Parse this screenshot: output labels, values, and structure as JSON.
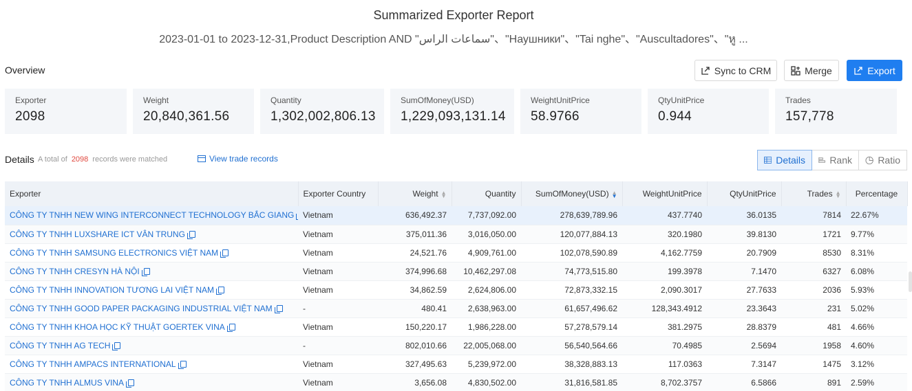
{
  "report": {
    "title": "Summarized Exporter Report",
    "subtitle": "2023-01-01 to 2023-12-31,Product Description AND \"سماعات الراس\"、\"Наушники\"、\"Tai nghe\"、\"Auscultadores\"、\"หู ..."
  },
  "overview": {
    "label": "Overview",
    "sync_label": "Sync to CRM",
    "merge_label": "Merge",
    "export_label": "Export"
  },
  "stats": [
    {
      "label": "Exporter",
      "value": "2098"
    },
    {
      "label": "Weight",
      "value": "20,840,361.56"
    },
    {
      "label": "Quantity",
      "value": "1,302,002,806.13"
    },
    {
      "label": "SumOfMoney(USD)",
      "value": "1,229,093,131.14"
    },
    {
      "label": "WeightUnitPrice",
      "value": "58.9766"
    },
    {
      "label": "QtyUnitPrice",
      "value": "0.944"
    },
    {
      "label": "Trades",
      "value": "157,778"
    }
  ],
  "details": {
    "label": "Details",
    "total_prefix": "A total of",
    "total_count": "2098",
    "total_suffix": "records were matched",
    "view_link": "View trade records",
    "tabs": [
      "Details",
      "Rank",
      "Ratio"
    ]
  },
  "table": {
    "headers": [
      "Exporter",
      "Exporter Country",
      "Weight",
      "Quantity",
      "SumOfMoney(USD)",
      "WeightUnitPrice",
      "QtyUnitPrice",
      "Trades",
      "Percentage"
    ],
    "rows": [
      [
        "CÔNG TY TNHH NEW WING INTERCONNECT TECHNOLOGY BẮC GIANG",
        "Vietnam",
        "636,492.37",
        "7,737,092.00",
        "278,639,789.96",
        "437.7740",
        "36.0135",
        "7814",
        "22.67%"
      ],
      [
        "CÔNG TY TNHH LUXSHARE ICT VÂN TRUNG",
        "Vietnam",
        "375,011.36",
        "3,016,050.00",
        "120,077,884.13",
        "320.1980",
        "39.8130",
        "1721",
        "9.77%"
      ],
      [
        "CÔNG TY TNHH SAMSUNG ELECTRONICS VIỆT NAM",
        "Vietnam",
        "24,521.76",
        "4,909,761.00",
        "102,078,590.89",
        "4,162.7759",
        "20.7909",
        "8530",
        "8.31%"
      ],
      [
        "CÔNG TY TNHH CRESYN HÀ NỘI",
        "Vietnam",
        "374,996.68",
        "10,462,297.08",
        "74,773,515.80",
        "199.3978",
        "7.1470",
        "6327",
        "6.08%"
      ],
      [
        "CÔNG TY TNHH INNOVATION TƯƠNG LAI VIỆT NAM",
        "Vietnam",
        "34,862.59",
        "2,624,806.00",
        "72,873,332.15",
        "2,090.3017",
        "27.7633",
        "2036",
        "5.93%"
      ],
      [
        "CÔNG TY TNHH GOOD PAPER PACKAGING INDUSTRIAL VIỆT NAM",
        "-",
        "480.41",
        "2,638,963.00",
        "61,657,496.62",
        "128,343.4912",
        "23.3643",
        "231",
        "5.02%"
      ],
      [
        "CÔNG TY TNHH KHOA HỌC KỸ THUẬT GOERTEK VINA",
        "Vietnam",
        "150,220.17",
        "1,986,228.00",
        "57,278,579.14",
        "381.2975",
        "28.8379",
        "481",
        "4.66%"
      ],
      [
        "CÔNG TY TNHH AG TECH",
        "-",
        "802,010.66",
        "22,005,068.00",
        "56,540,564.66",
        "70.4985",
        "2.5694",
        "1958",
        "4.60%"
      ],
      [
        "CÔNG TY TNHH AMPACS INTERNATIONAL",
        "Vietnam",
        "327,495.63",
        "5,239,972.00",
        "38,328,883.13",
        "117.0363",
        "7.3147",
        "1475",
        "3.12%"
      ],
      [
        "CÔNG TY TNHH ALMUS VINA",
        "Vietnam",
        "3,656.08",
        "4,830,502.00",
        "31,816,581.85",
        "8,702.3757",
        "6.5866",
        "891",
        "2.59%"
      ]
    ]
  }
}
